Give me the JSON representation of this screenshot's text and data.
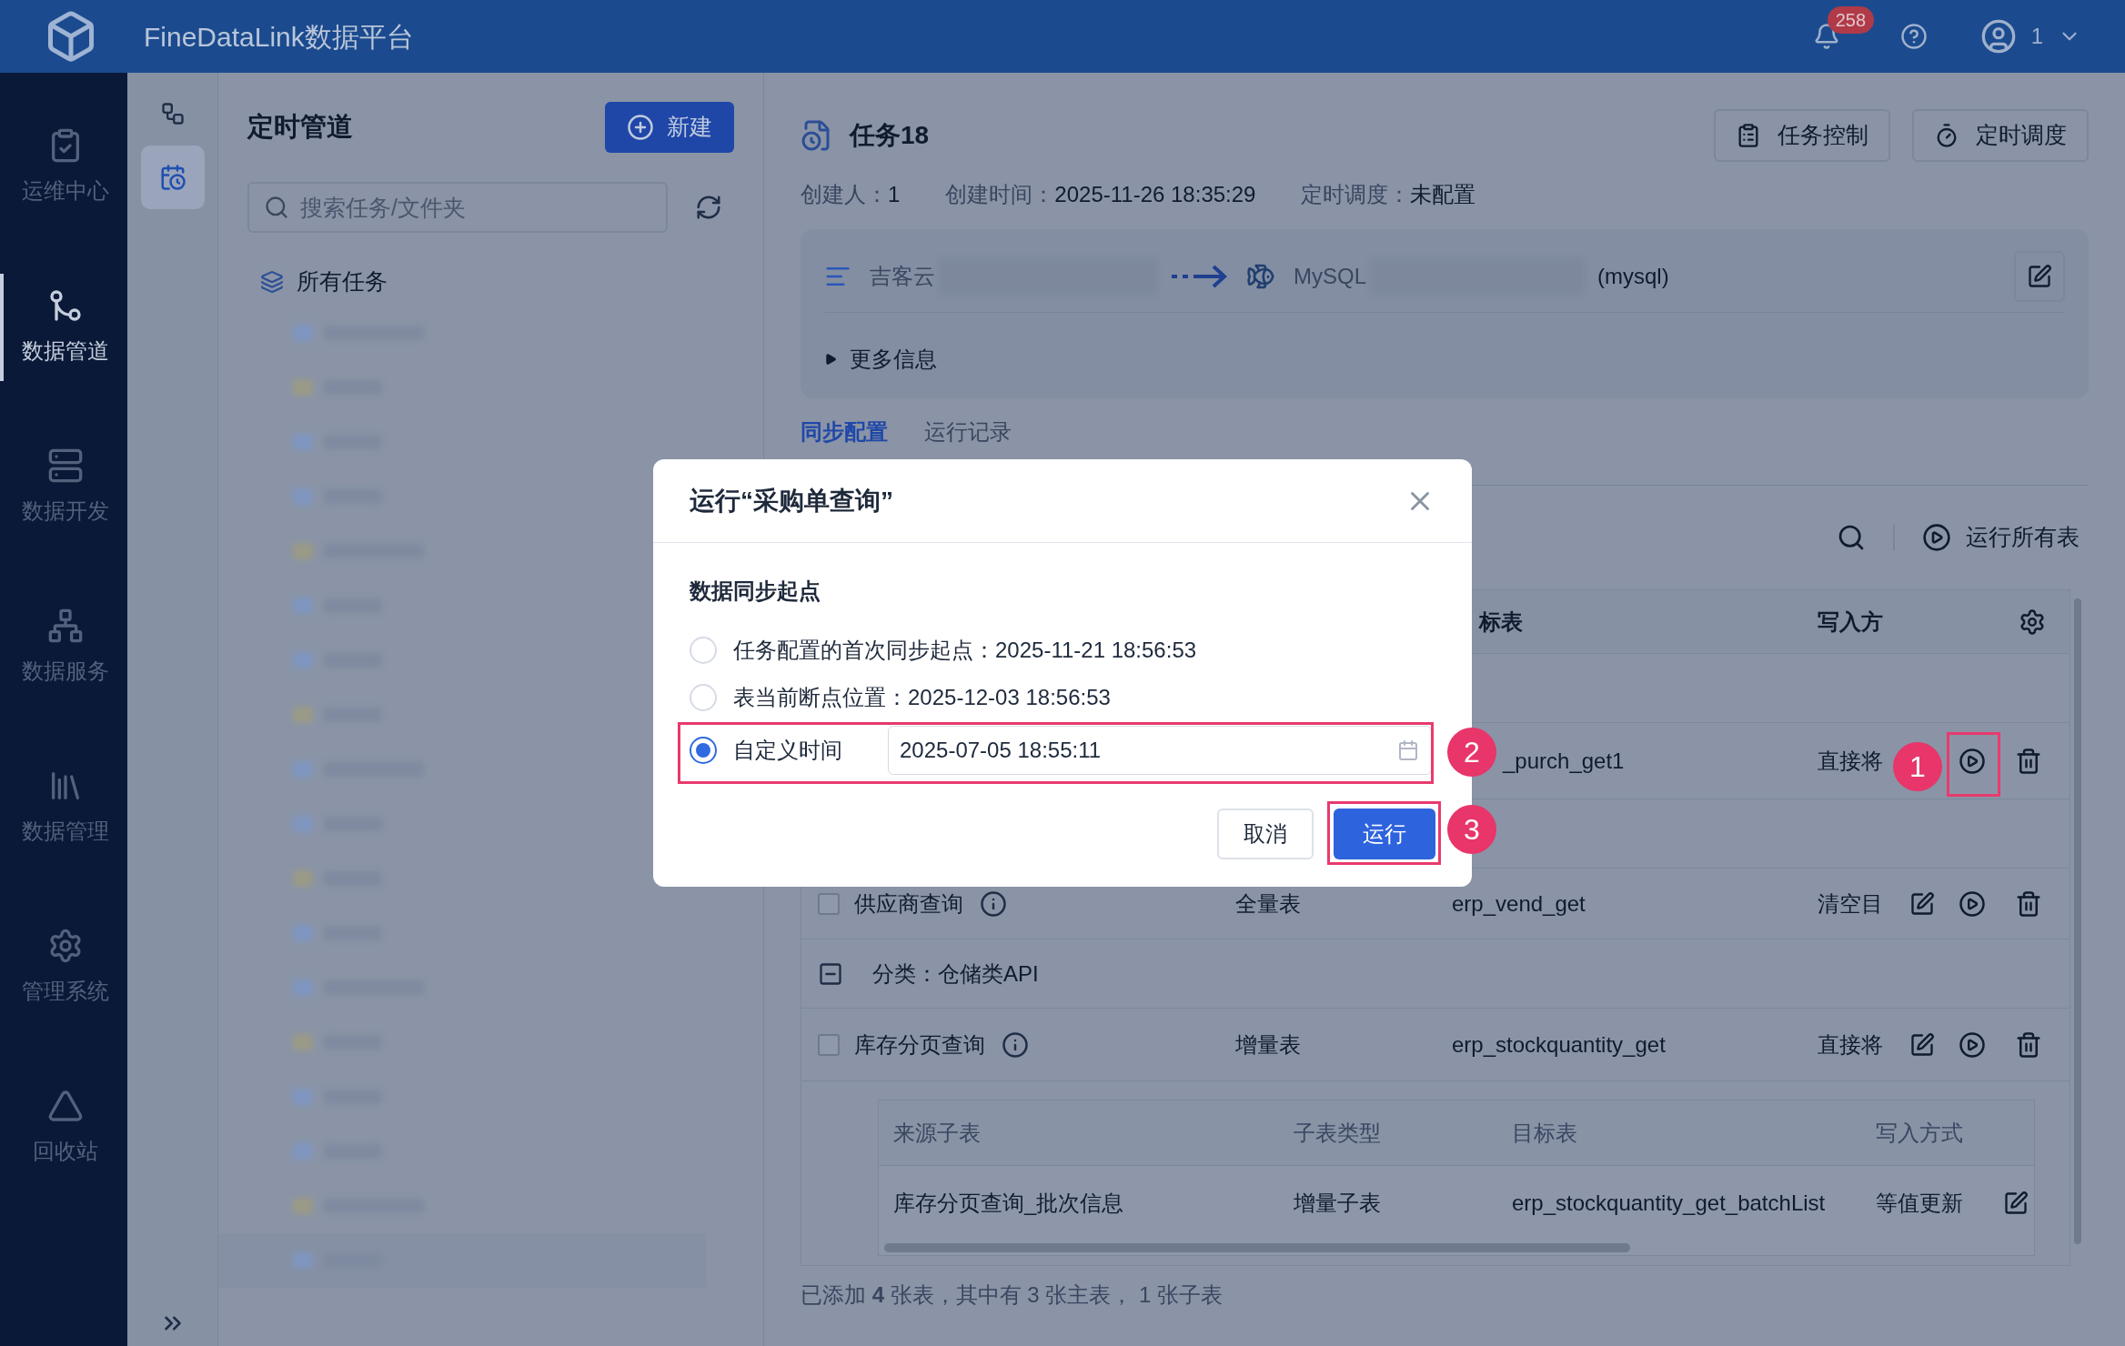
{
  "header": {
    "title": "FineDataLink数据平台",
    "notifications": "258",
    "user": "1"
  },
  "nav": [
    {
      "label": "运维中心",
      "selected": false
    },
    {
      "label": "数据管道",
      "selected": true
    },
    {
      "label": "数据开发",
      "selected": false
    },
    {
      "label": "数据服务",
      "selected": false
    },
    {
      "label": "数据管理",
      "selected": false
    },
    {
      "label": "管理系统",
      "selected": false
    },
    {
      "label": "回收站",
      "selected": false
    }
  ],
  "mode_strip": [
    {
      "selected": false
    },
    {
      "selected": true
    }
  ],
  "tree_panel": {
    "title": "定时管道",
    "new_button": "新建",
    "search": {
      "placeholder": "搜索任务/文件夹"
    },
    "root": "所有任务"
  },
  "task": {
    "title": "任务18",
    "buttons": [
      "任务控制",
      "定时调度"
    ],
    "meta": [
      {
        "label": "创建人：",
        "value": "1"
      },
      {
        "label": "创建时间：",
        "value": "2025-11-26 18:35:29"
      },
      {
        "label": "定时调度：",
        "value": "未配置"
      }
    ],
    "source": "吉客云",
    "target": "MySQL",
    "target_type": "(mysql)",
    "more": "更多信息"
  },
  "tabs": [
    {
      "label": "同步配置",
      "selected": true
    },
    {
      "label": "运行记录",
      "selected": false
    }
  ],
  "toolbar": {
    "run_all": "运行所有表"
  },
  "table": {
    "columns": [
      "标表",
      "写入方"
    ],
    "rows": [
      {
        "kind": "hidden"
      },
      {
        "kind": "table",
        "target": "_purch_get1",
        "write": "直接将"
      },
      {
        "kind": "hidden"
      },
      {
        "kind": "table",
        "name": "供应商查询",
        "type": "全量表",
        "target": "erp_vend_get",
        "write": "清空目",
        "edit": true,
        "checked": false
      },
      {
        "kind": "category",
        "name": "分类：仓储类API",
        "expanded": true
      },
      {
        "kind": "table",
        "name": "库存分页查询",
        "type": "增量表",
        "target": "erp_stockquantity_get",
        "write": "直接将",
        "edit": true,
        "checked": false
      }
    ],
    "subtable": {
      "columns": [
        "来源子表",
        "子表类型",
        "目标表",
        "写入方式"
      ],
      "rows": [
        [
          "库存分页查询_批次信息",
          "增量子表",
          "erp_stockquantity_get_batchList",
          "等值更新"
        ]
      ]
    }
  },
  "footer": "已添加 **4** 张表，其中有 3 张主表， 1 张子表",
  "modal": {
    "title": "运行“采购单查询”",
    "section": "数据同步起点",
    "options": [
      {
        "kind": "text",
        "label": "任务配置的首次同步起点：",
        "value": "2025-11-21 18:56:53",
        "selected": false
      },
      {
        "kind": "text",
        "label": "表当前断点位置：",
        "value": "2025-12-03 18:56:53",
        "selected": false
      },
      {
        "kind": "datetime",
        "label": "自定义时间",
        "value": "2025-07-05 18:55:11",
        "selected": true
      }
    ],
    "buttons": [
      {
        "label": "取消",
        "kind": "secondary"
      },
      {
        "label": "运行",
        "kind": "primary"
      }
    ]
  },
  "callouts": [
    "1",
    "2",
    "3"
  ]
}
